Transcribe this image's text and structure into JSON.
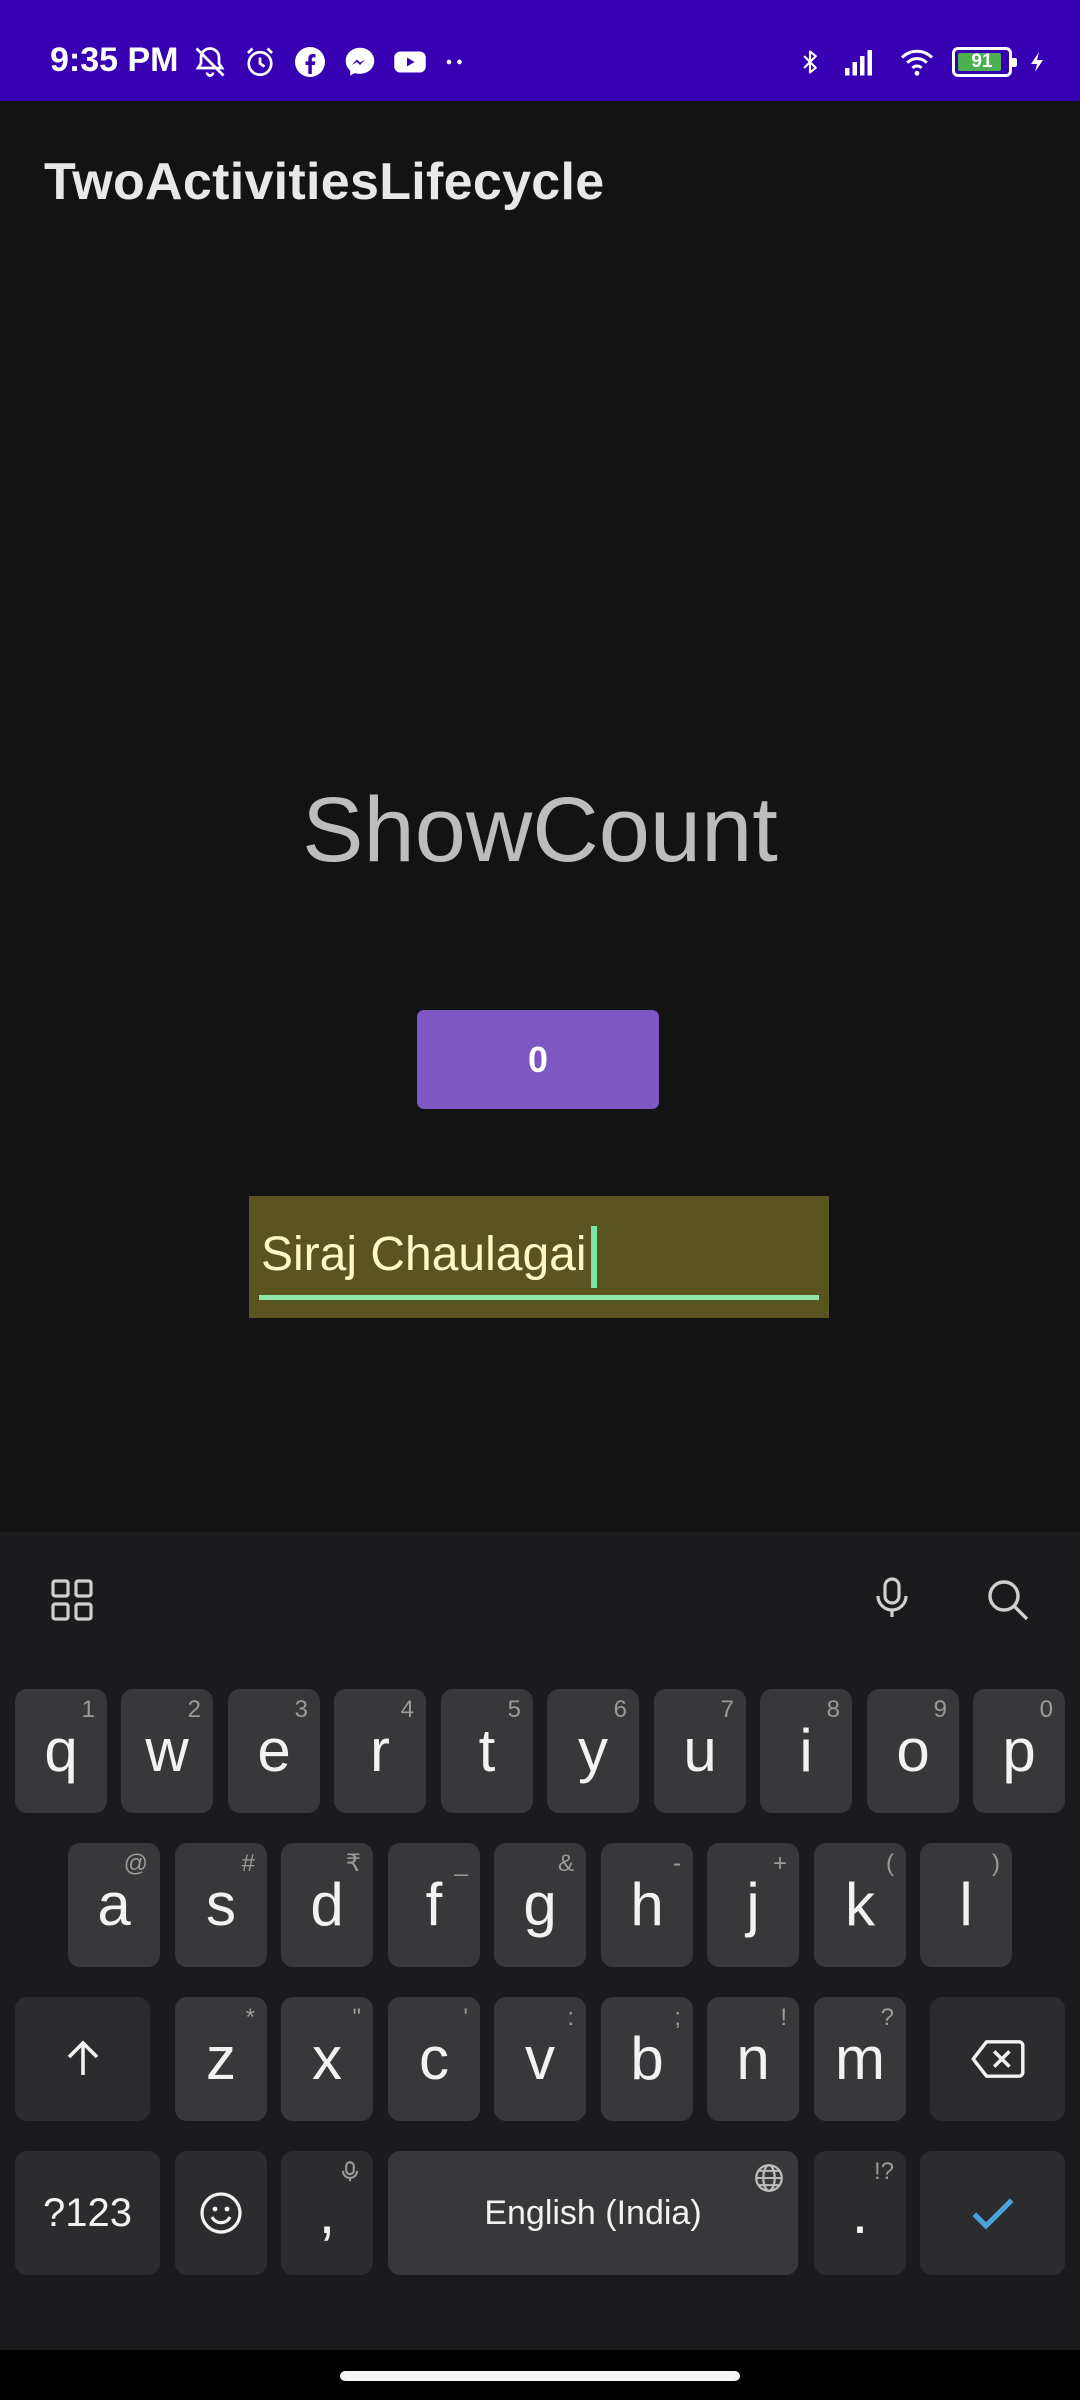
{
  "status_bar": {
    "time": "9:35 PM",
    "battery": "91",
    "icons_left": [
      "notifications-off-icon",
      "alarm-icon",
      "facebook-icon",
      "messenger-icon",
      "youtube-icon",
      "more-dots-icon"
    ],
    "icons_right": [
      "bluetooth-icon",
      "signal-icon",
      "wifi-icon",
      "battery-icon",
      "charging-icon"
    ],
    "color": "#3700b3"
  },
  "app": {
    "title": "TwoActivitiesLifecycle",
    "heading": "ShowCount",
    "count_button": "0",
    "name_input": "Siraj Chaulagai",
    "accent": "#7e57c2"
  },
  "keyboard": {
    "toolbar": [
      "apps-grid-icon",
      "microphone-icon",
      "search-icon"
    ],
    "row1": [
      {
        "k": "q",
        "h": "1"
      },
      {
        "k": "w",
        "h": "2"
      },
      {
        "k": "e",
        "h": "3"
      },
      {
        "k": "r",
        "h": "4"
      },
      {
        "k": "t",
        "h": "5"
      },
      {
        "k": "y",
        "h": "6"
      },
      {
        "k": "u",
        "h": "7"
      },
      {
        "k": "i",
        "h": "8"
      },
      {
        "k": "o",
        "h": "9"
      },
      {
        "k": "p",
        "h": "0"
      }
    ],
    "row2": [
      {
        "k": "a",
        "h": "@"
      },
      {
        "k": "s",
        "h": "#"
      },
      {
        "k": "d",
        "h": "₹"
      },
      {
        "k": "f",
        "h": "_"
      },
      {
        "k": "g",
        "h": "&"
      },
      {
        "k": "h",
        "h": "-"
      },
      {
        "k": "j",
        "h": "+"
      },
      {
        "k": "k",
        "h": "("
      },
      {
        "k": "l",
        "h": ")"
      }
    ],
    "row3": [
      {
        "k": "z",
        "h": "*"
      },
      {
        "k": "x",
        "h": "\""
      },
      {
        "k": "c",
        "h": "'"
      },
      {
        "k": "v",
        "h": ":"
      },
      {
        "k": "b",
        "h": ";"
      },
      {
        "k": "n",
        "h": "!"
      },
      {
        "k": "m",
        "h": "?"
      }
    ],
    "symbols_key": "?123",
    "comma_key": ",",
    "space_key": "English (India)",
    "period_key": ".",
    "period_hint": "!?",
    "enter_color": "#4aa3df"
  }
}
